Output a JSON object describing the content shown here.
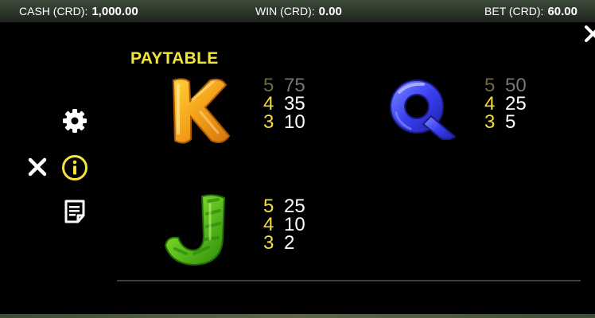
{
  "status": {
    "cash_label": "CASH (CRD):",
    "cash_value": "1,000.00",
    "win_label": "WIN (CRD):",
    "win_value": "0.00",
    "bet_label": "BET (CRD):",
    "bet_value": "60.00"
  },
  "paytable": {
    "title": "PAYTABLE",
    "symbols": [
      {
        "symbol": "K",
        "icon": "candy-k-icon",
        "color": "#f2a51a",
        "pays": [
          {
            "count": "5",
            "amount": "75"
          },
          {
            "count": "4",
            "amount": "35"
          },
          {
            "count": "3",
            "amount": "10"
          }
        ]
      },
      {
        "symbol": "Q",
        "icon": "candy-q-icon",
        "color": "#3a3ff0",
        "pays": [
          {
            "count": "5",
            "amount": "50"
          },
          {
            "count": "4",
            "amount": "25"
          },
          {
            "count": "3",
            "amount": "5"
          }
        ]
      },
      {
        "symbol": "J",
        "icon": "candy-j-icon",
        "color": "#5fc21d",
        "pays": [
          {
            "count": "5",
            "amount": "25"
          },
          {
            "count": "4",
            "amount": "10"
          },
          {
            "count": "3",
            "amount": "2"
          }
        ]
      }
    ]
  },
  "menu": {
    "icons": [
      "gear-icon",
      "info-icon",
      "document-icon",
      "close-icon"
    ],
    "accent": "#f5e43a"
  }
}
